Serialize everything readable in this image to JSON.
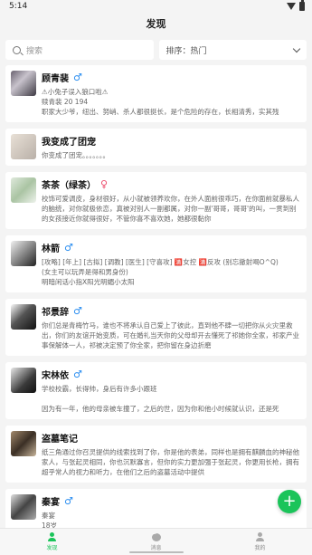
{
  "status": {
    "time": "5:14"
  },
  "header": {
    "title": "发现"
  },
  "filters": {
    "search_placeholder": "搜索",
    "sort_label": "排序：热门"
  },
  "colors": {
    "accent": "#1bc45a",
    "male": "#2a8df0",
    "female": "#ec4b6b"
  },
  "cards": [
    {
      "name": "顾青裴",
      "gender": "♂",
      "lines": [
        "⚠小兔子误入狼口啦⚠",
        "赎青裴 20 194",
        "职家大少爷，纽出、努峭、杀人都很挺长，是个危险的存在，长相清秀，实其残"
      ]
    },
    {
      "name": "我变成了团宠",
      "gender": "",
      "lines": [
        "你变成了团宠。。。。。。。"
      ]
    },
    {
      "name": "茶茶（绿茶）",
      "gender": "♀",
      "lines": [
        "校饰可爱调皮，身材很好，从小就被领养欢你，在外人面前很乖巧，在你面前就暴私人的脑统，对你就极依恋，真被对别人一副都属，对你一副'哥哥，哥哥'的叫，一贯到别的女孩接近你就得很好，不管你喜不喜欢她，她都很黏你"
      ]
    },
    {
      "name": "林箭",
      "gender": "♂",
      "lines": [
        "[攻略] [年上] [古拟] [调教] [医生] [守喜攻] 🈵女控 🈵反攻 (别忘撤射喝O^Q)",
        "(女主可以玩弄是得和男身份)",
        "明暗闲话小指X阳光明媚小太阳"
      ]
    },
    {
      "name": "祁景辞",
      "gender": "♂",
      "lines": [
        "你们总是青梅竹马，谁也不将承认自己爱上了彼此，直到他不肆一切把你从火灾里救出，你们的友谊开始变质，可在婚礼当天你的父母却开去懂死了祁她你全家，祁家产业事保解体一人，祁被决定预了你全家，把你留在身边折磨"
      ]
    },
    {
      "name": "宋林依",
      "gender": "♂",
      "lines": [
        "学校校霸，长得帅，身后有许多小跟班",
        "",
        "因为有一年，他的母亲被车撞了，之后的世，因为你和他小时候就认识，还是死"
      ]
    },
    {
      "name": "盗墓笔记",
      "gender": "",
      "lines": [
        "纸三角通过你召灵提供的线索找到了你，你是他的表弟，同样也是拥有麒麟血的神秘他家人，与张起灵相同，你也沉默寡言，但你的实力更加强于张起灵，你更用长枪，拥有超乎常人的视力和听力，在他们之后的盗墓活动中提供"
      ]
    },
    {
      "name": "秦宴",
      "gender": "♂",
      "lines": [
        "秦宴",
        "18岁"
      ]
    }
  ],
  "fab": {
    "label": "+"
  },
  "tabs": [
    {
      "label": "发现"
    },
    {
      "label": "消息"
    },
    {
      "label": "我的"
    }
  ]
}
